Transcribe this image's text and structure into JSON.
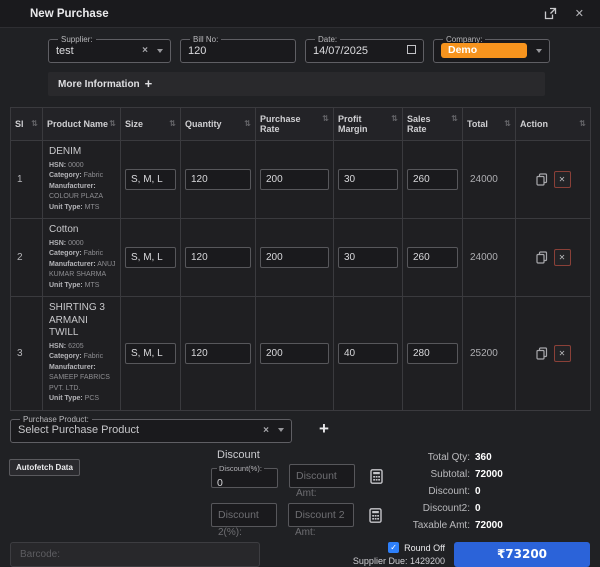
{
  "dialog": {
    "title": "New Purchase"
  },
  "fields": {
    "supplier": {
      "label": "Supplier:",
      "value": "test"
    },
    "bill_no": {
      "label": "Bill No:",
      "value": "120"
    },
    "date": {
      "label": "Date:",
      "value": "14/07/2025"
    },
    "company": {
      "label": "Company:",
      "value": "Demo"
    }
  },
  "more_info": {
    "label": "More Information",
    "plus": "+"
  },
  "table": {
    "columns": [
      "Sl",
      "Product Name",
      "Size",
      "Quantity",
      "Purchase Rate",
      "Profit Margin",
      "Sales Rate",
      "Total",
      "Action"
    ],
    "sort_glyph": "⇅",
    "detail_labels": {
      "hsn": "HSN:",
      "category": "Category:",
      "manufacturer": "Manufacturer:",
      "unit_type": "Unit Type:"
    },
    "rows": [
      {
        "sl": "1",
        "name": "DENIM",
        "hsn": "0000",
        "category": "Fabric",
        "manufacturer": "COLOUR PLAZA",
        "unit_type": "MTS",
        "size": "S, M, L",
        "quantity": "120",
        "purchase_rate": "200",
        "profit_margin": "30",
        "sales_rate": "260",
        "total": "24000"
      },
      {
        "sl": "2",
        "name": "Cotton",
        "hsn": "0000",
        "category": "Fabric",
        "manufacturer": "ANUJ KUMAR SHARMA",
        "unit_type": "MTS",
        "size": "S, M, L",
        "quantity": "120",
        "purchase_rate": "200",
        "profit_margin": "30",
        "sales_rate": "260",
        "total": "24000"
      },
      {
        "sl": "3",
        "name": "SHIRTING 3 ARMANI TWILL",
        "hsn": "6205",
        "category": "Fabric",
        "manufacturer": "SAMEEP FABRICS PVT. LTD.",
        "unit_type": "PCS",
        "size": "S, M, L",
        "quantity": "120",
        "purchase_rate": "200",
        "profit_margin": "40",
        "sales_rate": "280",
        "total": "25200"
      }
    ],
    "remove_glyph": "✕"
  },
  "purchase_product": {
    "label": "Purchase Product:",
    "placeholder": "Select Purchase Product",
    "add_glyph": "+"
  },
  "autofetch_label": "Autofetch Data",
  "discount": {
    "heading": "Discount",
    "pct1_label": "Discount(%):",
    "pct1_value": "0",
    "amt1_placeholder": "Discount",
    "amt1_overflow": "Amt:",
    "pct2_placeholder": "Discount",
    "pct2_overflow": "2(%):",
    "amt2_placeholder": "Discount 2",
    "amt2_overflow": "Amt:"
  },
  "totals": {
    "rows": [
      {
        "label": "Total Qty:",
        "value": "360"
      },
      {
        "label": "Subtotal:",
        "value": "72000"
      },
      {
        "label": "Discount:",
        "value": "0"
      },
      {
        "label": "Discount2:",
        "value": "0"
      },
      {
        "label": "Taxable Amt:",
        "value": "72000"
      }
    ]
  },
  "footer": {
    "barcode_placeholder": "Barcode:",
    "round_off_label": "Round Off",
    "check_glyph": "✓",
    "supplier_due": "Supplier Due: 1429200",
    "pay_button": "₹73200"
  },
  "colors": {
    "accent_orange": "#f7941e",
    "accent_blue": "#2b63d9",
    "checkbox_blue": "#2d7ff9",
    "remove_border": "#8a4038"
  }
}
